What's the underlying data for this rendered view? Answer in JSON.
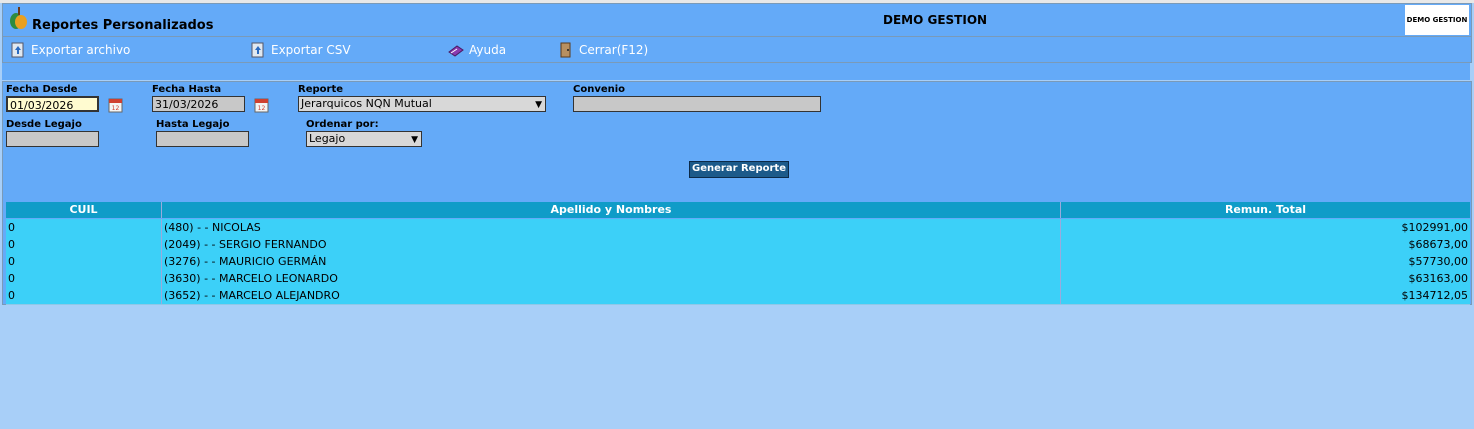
{
  "header": {
    "title": "Reportes Personalizados",
    "company": "DEMO GESTION",
    "brand_box_text": "DEMO GESTION"
  },
  "toolbar": {
    "export_file": "Exportar archivo",
    "export_csv": "Exportar CSV",
    "help": "Ayuda",
    "close": "Cerrar(F12)"
  },
  "form": {
    "fecha_desde_label": "Fecha Desde",
    "fecha_desde_value": "01/03/2026",
    "fecha_hasta_label": "Fecha Hasta",
    "fecha_hasta_value": "31/03/2026",
    "reporte_label": "Reporte",
    "reporte_value": "Jerarquicos NQN Mutual",
    "convenio_label": "Convenio",
    "convenio_value": "",
    "desde_legajo_label": "Desde Legajo",
    "desde_legajo_value": "",
    "hasta_legajo_label": "Hasta Legajo",
    "hasta_legajo_value": "",
    "ordenar_label": "Ordenar por:",
    "ordenar_value": "Legajo",
    "generate_button": "Generar Reporte"
  },
  "table": {
    "headers": [
      "CUIL",
      "Apellido y Nombres",
      "Remun. Total"
    ],
    "rows": [
      {
        "cuil": "0",
        "name": "(480) - - NICOLAS",
        "total": "$102991,00"
      },
      {
        "cuil": "0",
        "name": "(2049) - - SERGIO FERNANDO",
        "total": "$68673,00"
      },
      {
        "cuil": "0",
        "name": "(3276) - - MAURICIO GERMÁN",
        "total": "$57730,00"
      },
      {
        "cuil": "0",
        "name": "(3630) - - MARCELO LEONARDO",
        "total": "$63163,00"
      },
      {
        "cuil": "0",
        "name": "(3652) - - MARCELO ALEJANDRO",
        "total": "$134712,05"
      }
    ]
  },
  "colors": {
    "background": "#a8cff8",
    "panel": "#64aaf8",
    "table_header": "#0f9cc8",
    "table_row": "#3cd0f8",
    "button": "#1c5a8a"
  }
}
